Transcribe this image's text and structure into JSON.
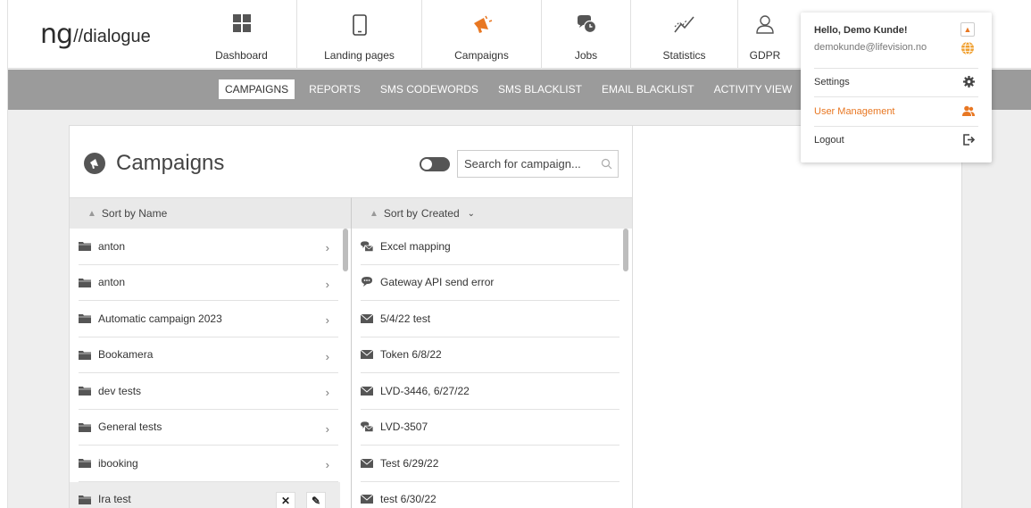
{
  "logo": {
    "mark": "ng",
    "text": "//dialogue"
  },
  "nav": [
    {
      "label": "Dashboard",
      "icon": "dashboard-grid-icon"
    },
    {
      "label": "Landing pages",
      "icon": "mobile-phone-icon"
    },
    {
      "label": "Campaigns",
      "icon": "megaphone-icon",
      "active": true
    },
    {
      "label": "Jobs",
      "icon": "chat-bubbles-icon"
    },
    {
      "label": "Statistics",
      "icon": "line-chart-icon"
    },
    {
      "label": "GDPR",
      "icon": "user-outline-icon"
    }
  ],
  "subnav": [
    {
      "label": "CAMPAIGNS",
      "active": true
    },
    {
      "label": "REPORTS"
    },
    {
      "label": "SMS CODEWORDS"
    },
    {
      "label": "SMS BLACKLIST"
    },
    {
      "label": "EMAIL BLACKLIST"
    },
    {
      "label": "ACTIVITY VIEW"
    }
  ],
  "panel": {
    "title": "Campaigns",
    "search_placeholder": "Search for campaign...",
    "left_sort": "Sort by Name",
    "right_sort_prefix": "Sort by",
    "right_sort_value": "Created"
  },
  "folders": [
    {
      "name": "anton"
    },
    {
      "name": "anton"
    },
    {
      "name": "Automatic campaign 2023"
    },
    {
      "name": "Bookamera"
    },
    {
      "name": "dev tests"
    },
    {
      "name": "General tests"
    },
    {
      "name": "ibooking"
    },
    {
      "name": "Ira test",
      "selected": true
    }
  ],
  "campaigns": [
    {
      "name": "Excel mapping",
      "icon": "sms-email-icon"
    },
    {
      "name": "Gateway API send error",
      "icon": "sms-bubble-icon"
    },
    {
      "name": "5/4/22 test",
      "icon": "envelope-icon"
    },
    {
      "name": "Token 6/8/22",
      "icon": "envelope-icon"
    },
    {
      "name": "LVD-3446, 6/27/22",
      "icon": "envelope-icon"
    },
    {
      "name": "LVD-3507",
      "icon": "sms-email-icon"
    },
    {
      "name": "Test 6/29/22",
      "icon": "envelope-icon"
    },
    {
      "name": "test 6/30/22",
      "icon": "envelope-icon"
    }
  ],
  "user_menu": {
    "greeting": "Hello, Demo Kunde!",
    "email": "demokunde@lifevision.no",
    "items": [
      {
        "label": "Settings",
        "icon": "gear-icon"
      },
      {
        "label": "User Management",
        "icon": "users-icon",
        "highlight": true
      },
      {
        "label": "Logout",
        "icon": "logout-icon"
      }
    ]
  },
  "colors": {
    "accent": "#e87722",
    "subbar": "#9b9b9b",
    "background": "#eeeeee"
  }
}
